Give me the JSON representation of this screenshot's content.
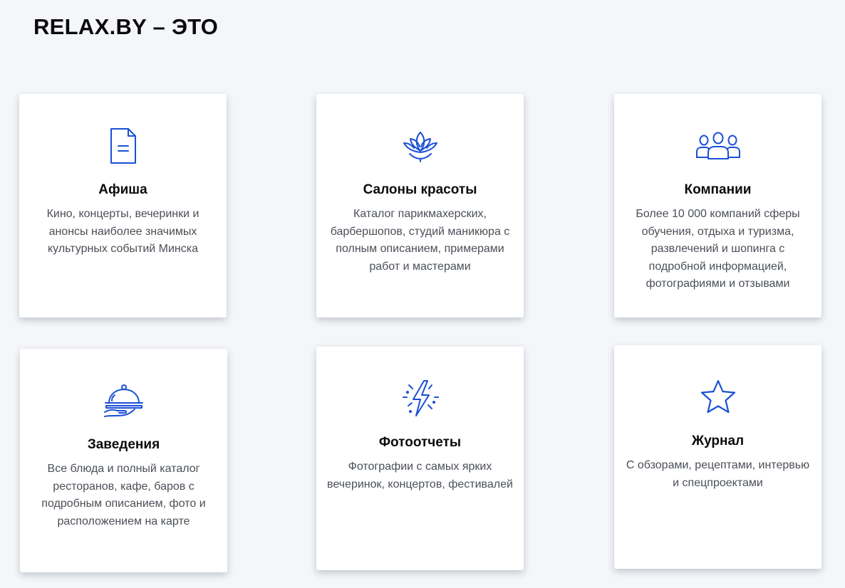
{
  "header": {
    "title": "RELAX.BY – ЭТО"
  },
  "colors": {
    "accent": "#1b4fd6",
    "background": "#f4f6f9",
    "card": "#ffffff",
    "description": "#4a4f57"
  },
  "cards": [
    {
      "icon": "document-icon",
      "title": "Афиша",
      "description": "Кино, концерты, вечеринки и анонсы наиболее значимых культурных событий Минска"
    },
    {
      "icon": "lotus-icon",
      "title": "Салоны красоты",
      "description": "Каталог парикмахерских, барбершопов, студий маникюра с полным описанием, примерами работ и мастерами"
    },
    {
      "icon": "people-group-icon",
      "title": "Компании",
      "description": "Более 10 000 компаний сферы обучения, отдыха и туризма, развлечений и шопинга с подробной информацией, фотографиями и отзывами"
    },
    {
      "icon": "serving-cloche-icon",
      "title": "Заведения",
      "description": "Все блюда и полный каталог ресторанов, кафе, баров с подробным описанием, фото и расположением на карте"
    },
    {
      "icon": "lightning-sparkle-icon",
      "title": "Фотоотчеты",
      "description": "Фотографии с самых ярких вечеринок, концертов, фестивалей"
    },
    {
      "icon": "star-icon",
      "title": "Журнал",
      "description": "С обзорами, рецептами, интервью и спецпроектами"
    }
  ]
}
